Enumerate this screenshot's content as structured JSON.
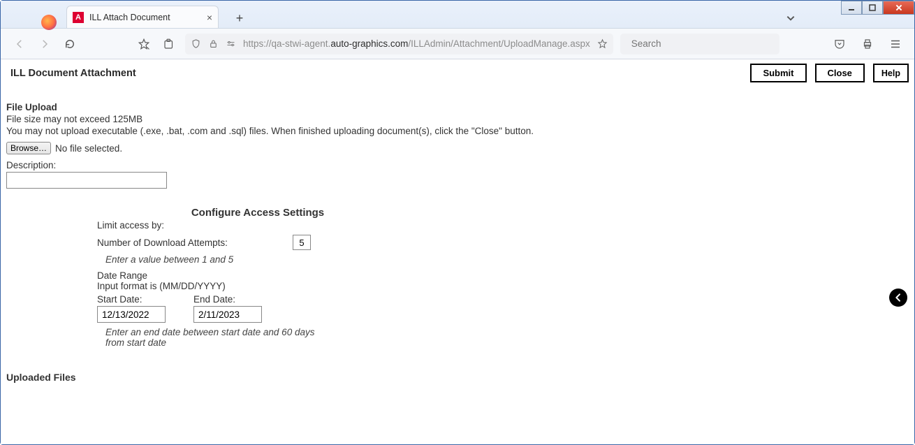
{
  "window": {
    "tab_title": "ILL Attach Document"
  },
  "toolbar": {
    "url_prefix": "https://qa-stwi-agent.",
    "url_host": "auto-graphics.com",
    "url_path": "/ILLAdmin/Attachment/UploadManage.aspx",
    "search_placeholder": "Search"
  },
  "header": {
    "title": "ILL Document Attachment",
    "submit_label": "Submit",
    "close_label": "Close",
    "help_label": "Help"
  },
  "upload": {
    "section_title": "File Upload",
    "size_hint": "File size may not exceed 125MB",
    "type_hint": "You may not upload executable (.exe, .bat, .com and .sql) files. When finished uploading document(s), click the \"Close\" button.",
    "browse_label": "Browse…",
    "no_file_text": "No file selected.",
    "description_label": "Description:",
    "description_value": ""
  },
  "config": {
    "title": "Configure Access Settings",
    "limit_label": "Limit access by:",
    "downloads_label": "Number of Download Attempts:",
    "downloads_value": "5",
    "downloads_hint": "Enter a value between 1 and 5",
    "date_range_label": "Date Range",
    "input_format_label": "Input format is (MM/DD/YYYY)",
    "start_date_label": "Start Date:",
    "start_date_value": "12/13/2022",
    "end_date_label": "End Date:",
    "end_date_value": "2/11/2023",
    "date_hint": "Enter an end date between start date and 60 days from start date"
  },
  "uploaded": {
    "title": "Uploaded Files"
  }
}
